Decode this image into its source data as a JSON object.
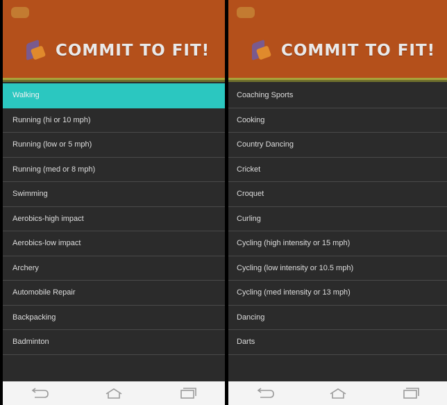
{
  "app": {
    "title": "COMMIT TO FIT!"
  },
  "left_list": [
    "Walking",
    "Running (hi or 10 mph)",
    "Running (low or 5 mph)",
    "Running (med or 8 mph)",
    "Swimming",
    "Aerobics-high impact",
    "Aerobics-low impact",
    "Archery",
    "Automobile Repair",
    "Backpacking",
    "Badminton"
  ],
  "right_list": [
    "Coaching Sports",
    "Cooking",
    "Country Dancing",
    "Cricket",
    "Croquet",
    "Curling",
    "Cycling (high intensity or 15 mph)",
    "Cycling (low intensity or 10.5 mph)",
    "Cycling (med intensity or 13 mph)",
    "Dancing",
    "Darts"
  ],
  "selected_left": "Walking",
  "colors": {
    "header": "#b4501b",
    "selected": "#2bc7c0",
    "list_bg": "#2b2b2b",
    "navbar": "#f4f4f4"
  },
  "icons": [
    "back-icon",
    "home-icon",
    "recents-icon",
    "menu-icon",
    "logo-icon"
  ]
}
